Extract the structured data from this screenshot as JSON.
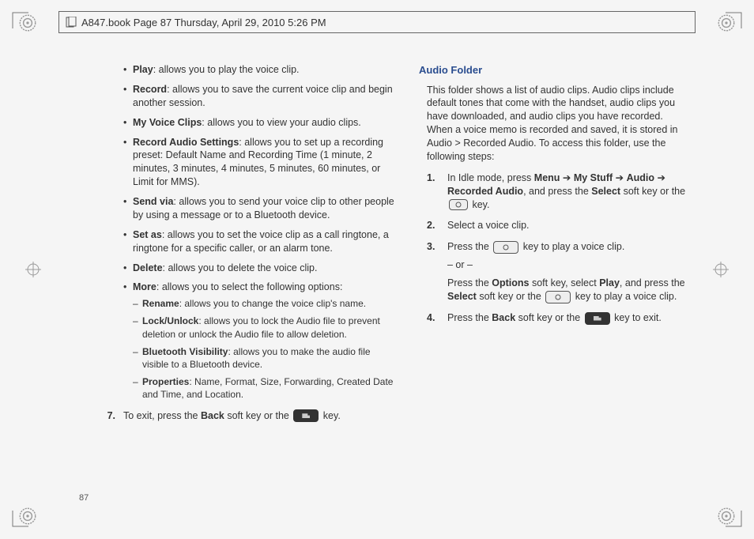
{
  "header": {
    "text": "A847.book  Page 87  Thursday, April 29, 2010  5:26 PM"
  },
  "page_number": "87",
  "left": {
    "bullets": [
      {
        "label": "Play",
        "desc": ": allows you to play the voice clip."
      },
      {
        "label": "Record",
        "desc": ": allows you to save the current voice clip and begin another session."
      },
      {
        "label": "My Voice Clips",
        "desc": ": allows you to view your audio clips."
      },
      {
        "label": "Record Audio Settings",
        "desc": ": allows you to set up a recording preset: Default Name and Recording Time (1 minute, 2 minutes, 3 minutes, 4 minutes, 5 minutes, 60 minutes, or Limit for MMS)."
      },
      {
        "label": "Send via",
        "desc": ": allows you to send your voice clip to other people by using a message or to a Bluetooth device."
      },
      {
        "label": "Set as",
        "desc": ": allows you to set the voice clip as a call ringtone, a ringtone for a specific caller, or an alarm tone."
      },
      {
        "label": "Delete",
        "desc": ": allows you to delete the voice clip."
      },
      {
        "label": "More",
        "desc": ": allows you to select the following options:"
      }
    ],
    "more_sub": [
      {
        "label": "Rename",
        "desc": ": allows you to change the voice clip's name."
      },
      {
        "label": "Lock/Unlock",
        "desc": ": allows you to lock the Audio file to prevent deletion or unlock the Audio file to allow deletion."
      },
      {
        "label": "Bluetooth Visibility",
        "desc": ": allows you to make the audio file visible to a Bluetooth device."
      },
      {
        "label": "Properties",
        "desc": ": Name, Format, Size, Forwarding, Created Date and Time, and Location."
      }
    ],
    "step7": {
      "num": "7.",
      "pre": "To exit, press the ",
      "back": "Back",
      "mid": " soft key or the ",
      "post": " key."
    }
  },
  "right": {
    "heading": "Audio Folder",
    "intro": "This folder shows a list of audio clips. Audio clips include default tones that come with the handset, audio clips you have downloaded, and audio clips you have recorded. When a voice memo is recorded and saved, it is stored in Audio > Recorded Audio. To access this folder, use the following steps:",
    "s1": {
      "num": "1.",
      "a": "In Idle mode, press ",
      "menu": "Menu",
      "arr": " ➔ ",
      "mystuff": "My Stuff",
      "audio": "Audio",
      "rec": "Recorded Audio",
      "b": ", and press the ",
      "select": "Select",
      "c": " soft key or the ",
      "d": " key."
    },
    "s2": {
      "num": "2.",
      "text": "Select a voice clip."
    },
    "s3": {
      "num": "3.",
      "a": "Press the ",
      "b": " key to play a voice clip.",
      "or": "– or –",
      "c": "Press the ",
      "options": "Options",
      "d": " soft key, select ",
      "play": "Play",
      "e": ", and press the ",
      "select": "Select",
      "f": " soft key or the ",
      "g": " key to play a voice clip."
    },
    "s4": {
      "num": "4.",
      "a": "Press the ",
      "back": "Back",
      "b": " soft key or the ",
      "c": " key to exit."
    }
  }
}
